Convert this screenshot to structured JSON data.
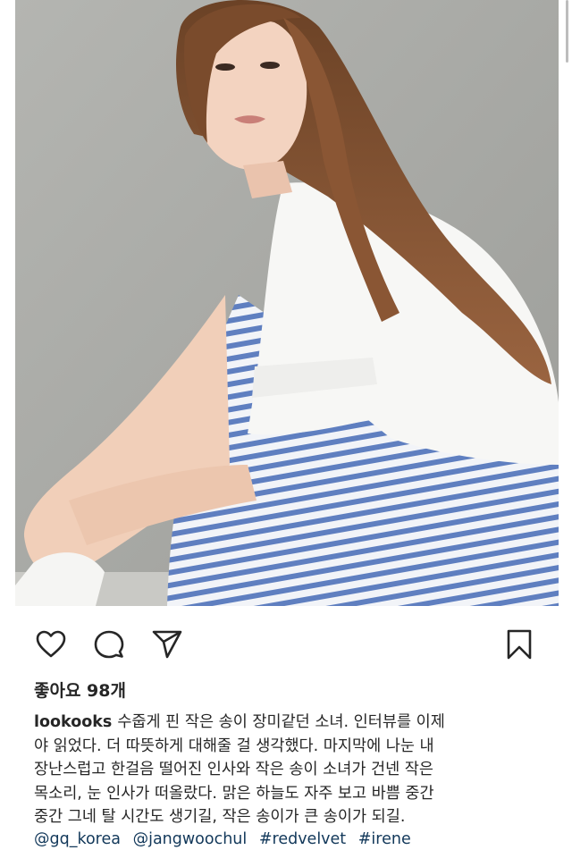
{
  "post": {
    "image_description_icon": "portrait-photo",
    "actions": {
      "like_icon": "heart-icon",
      "comment_icon": "comment-icon",
      "share_icon": "paper-plane-icon",
      "save_icon": "bookmark-icon"
    },
    "likes_text": "좋아요 98개",
    "caption": {
      "username": "lookooks",
      "lines": [
        "수줍게 핀 작은 송이 장미같던 소녀. 인터뷰를 이제",
        "야 읽었다. 더 따뜻하게 대해줄 걸 생각했다. 마지막에 나눈 내",
        "장난스럽고 한걸음 떨어진 인사와 작은 송이 소녀가 건넨 작은",
        "목소리, 눈 인사가 떠올랐다. 맑은 하늘도 자주 보고 바쁨 중간",
        "중간 그네 탈 시간도 생기길, 작은 송이가 큰 송이가 되길."
      ]
    },
    "tags": [
      "@gq_korea",
      "@jangwoochul",
      "#redvelvet",
      "#irene"
    ]
  },
  "colors": {
    "text": "#262626",
    "tag": "#12385a",
    "background": "#ffffff"
  }
}
